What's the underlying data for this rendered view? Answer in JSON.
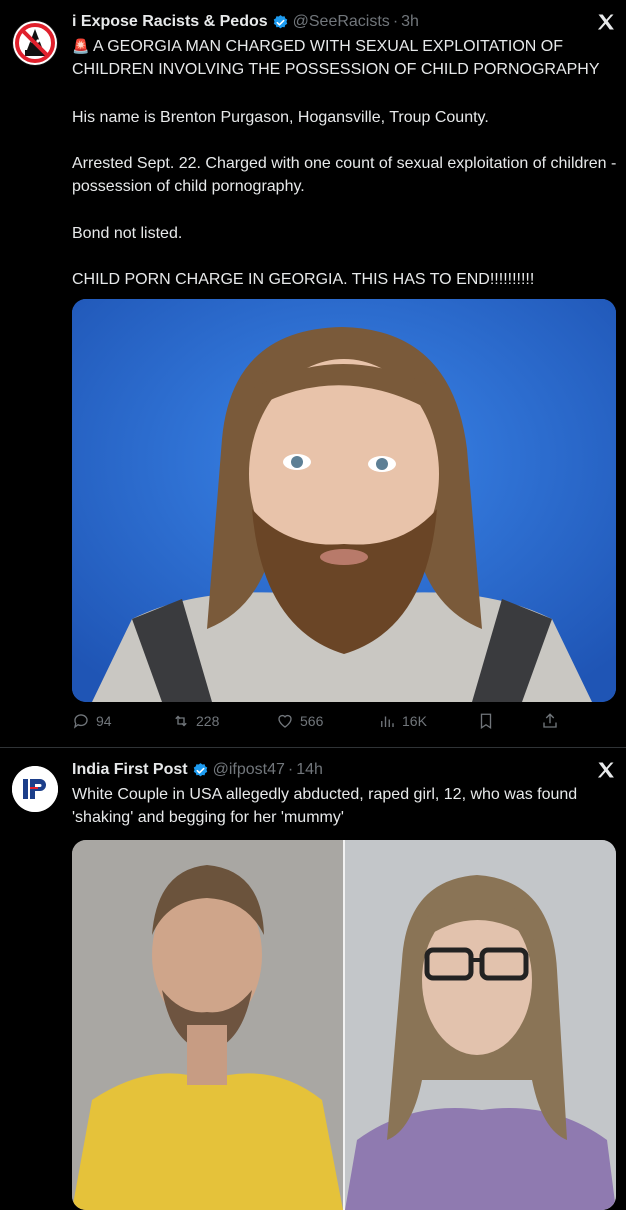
{
  "tweet1": {
    "name": "i Expose Racists & Pedos",
    "handle": "@SeeRacists",
    "sep": "·",
    "time": "3h",
    "headline_emoji": "🚨",
    "headline": "A GEORGIA MAN CHARGED WITH SEXUAL EXPLOITATION OF CHILDREN INVOLVING THE POSSESSION OF CHILD PORNOGRAPHY",
    "p1": "His name is Brenton Purgason, Hogansville, Troup County.",
    "p2": "Arrested Sept. 22. Charged with one count of sexual exploitation of children - possession of child pornography.",
    "p3": "Bond not listed.",
    "p4": "CHILD PORN CHARGE IN GEORGIA. THIS HAS TO END!!!!!!!!!!",
    "stats": {
      "replies": "94",
      "reposts": "228",
      "likes": "566",
      "views": "16K"
    }
  },
  "tweet2": {
    "name": "India First Post",
    "handle": "@ifpost47",
    "sep": "·",
    "time": "14h",
    "text": "White Couple in USA allegedly abducted, raped girl, 12, who was found 'shaking' and begging for her 'mummy'"
  },
  "icons": {
    "verified": "verified-badge-icon",
    "x_logo": "x-logo-icon",
    "reply": "reply-icon",
    "repost": "repost-icon",
    "like": "heart-icon",
    "views": "views-icon",
    "bookmark": "bookmark-icon",
    "share": "share-icon"
  },
  "colors": {
    "background": "#000000",
    "text": "#e7e9ea",
    "muted": "#71767b",
    "verified": "#1d9bf0",
    "mugshot_bg": "#2f6fd6"
  }
}
